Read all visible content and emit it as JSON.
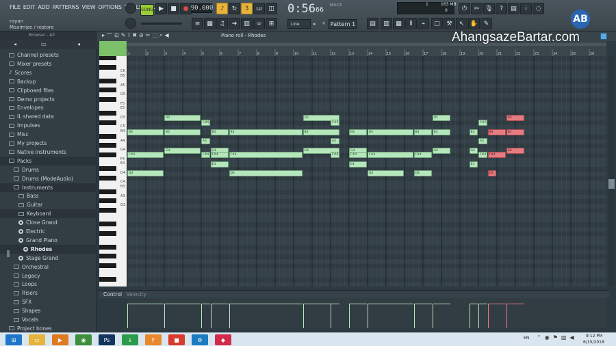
{
  "menu": [
    "FILE",
    "EDIT",
    "ADD",
    "PATTERNS",
    "VIEW",
    "OPTIONS",
    "TOOLS",
    "HELP"
  ],
  "hint": {
    "name": "rayan",
    "description": "Maximize / restore"
  },
  "transport": {
    "mode": "SONG",
    "tempo": "90.000",
    "time": "0:56",
    "time_cs": "66",
    "time_unit": "M:S:CS"
  },
  "monitor": {
    "cpu": "1",
    "memory": "163 MB",
    "poly": "0"
  },
  "toolbar": {
    "snap": "Line",
    "pattern": "Pattern 1"
  },
  "browser": {
    "header": "Browser - All",
    "items": [
      {
        "label": "Channel presets",
        "indent": 1,
        "icon": "folder"
      },
      {
        "label": "Mixer presets",
        "indent": 1,
        "icon": "folder"
      },
      {
        "label": "Scores",
        "indent": 1,
        "icon": "note"
      },
      {
        "label": "Backup",
        "indent": 1,
        "icon": "folder"
      },
      {
        "label": "Clipboard files",
        "indent": 1,
        "icon": "folder"
      },
      {
        "label": "Demo projects",
        "indent": 1,
        "icon": "folder"
      },
      {
        "label": "Envelopes",
        "indent": 1,
        "icon": "folder"
      },
      {
        "label": "IL shared data",
        "indent": 1,
        "icon": "folder"
      },
      {
        "label": "Impulses",
        "indent": 1,
        "icon": "folder"
      },
      {
        "label": "Misc",
        "indent": 1,
        "icon": "folder"
      },
      {
        "label": "My projects",
        "indent": 1,
        "icon": "folder"
      },
      {
        "label": "Native Instruments",
        "indent": 1,
        "icon": "folder"
      },
      {
        "label": "Packs",
        "indent": 1,
        "icon": "folder",
        "selected": true
      },
      {
        "label": "Drums",
        "indent": 2,
        "icon": "folder"
      },
      {
        "label": "Drums (ModeAudio)",
        "indent": 2,
        "icon": "folder"
      },
      {
        "label": "Instruments",
        "indent": 2,
        "icon": "folder",
        "selected": true
      },
      {
        "label": "Bass",
        "indent": 3,
        "icon": "folder"
      },
      {
        "label": "Guitar",
        "indent": 3,
        "icon": "folder"
      },
      {
        "label": "Keyboard",
        "indent": 3,
        "icon": "folder",
        "selected": true
      },
      {
        "label": "Close Grand",
        "indent": 3,
        "icon": "gear"
      },
      {
        "label": "Electric",
        "indent": 3,
        "icon": "gear"
      },
      {
        "label": "Grand Piano",
        "indent": 3,
        "icon": "gear"
      },
      {
        "label": "Rhodes",
        "indent": 4,
        "icon": "gear",
        "selected": true,
        "bold": true
      },
      {
        "label": "Stage Grand",
        "indent": 3,
        "icon": "gear"
      },
      {
        "label": "Orchestral",
        "indent": 2,
        "icon": "folder"
      },
      {
        "label": "Legacy",
        "indent": 2,
        "icon": "folder"
      },
      {
        "label": "Loops",
        "indent": 2,
        "icon": "folder"
      },
      {
        "label": "Risers",
        "indent": 2,
        "icon": "folder"
      },
      {
        "label": "SFX",
        "indent": 2,
        "icon": "folder"
      },
      {
        "label": "Shapes",
        "indent": 2,
        "icon": "folder"
      },
      {
        "label": "Vocals",
        "indent": 2,
        "icon": "folder"
      },
      {
        "label": "Project bones",
        "indent": 1,
        "icon": "folder"
      }
    ]
  },
  "piano_roll": {
    "title": "Piano roll - Rhodes",
    "bars": [
      "1",
      "2",
      "3",
      "4",
      "5",
      "6",
      "7",
      "8",
      "9",
      "10",
      "11",
      "12",
      "13",
      "14",
      "15",
      "16",
      "17",
      "18",
      "19",
      "20",
      "21",
      "22",
      "23",
      "24",
      "25",
      "26"
    ],
    "key_labels": [
      "C6",
      "B5",
      "A5",
      "G5",
      "F5",
      "E5",
      "D5",
      "C5",
      "B4",
      "A4",
      "G4",
      "F4",
      "E4",
      "D4",
      "C4",
      "B3",
      "A3",
      "G3"
    ],
    "notes": [
      {
        "pitch": "D5",
        "start": 3.0,
        "len": 2.0,
        "color": "green"
      },
      {
        "pitch": "D5",
        "start": 10.5,
        "len": 2.0,
        "color": "green"
      },
      {
        "pitch": "D5",
        "start": 17.5,
        "len": 1.0,
        "color": "green"
      },
      {
        "pitch": "D5",
        "start": 21.5,
        "len": 1.0,
        "color": "red"
      },
      {
        "pitch": "C#5",
        "start": 5.0,
        "len": 0.5,
        "color": "green"
      },
      {
        "pitch": "C#5",
        "start": 12.0,
        "len": 0.5,
        "color": "green"
      },
      {
        "pitch": "C#5",
        "start": 20.0,
        "len": 0.5,
        "color": "green"
      },
      {
        "pitch": "B4",
        "start": 1.0,
        "len": 2.0,
        "color": "green"
      },
      {
        "pitch": "B4",
        "start": 3.0,
        "len": 2.0,
        "color": "green"
      },
      {
        "pitch": "B4",
        "start": 5.5,
        "len": 1.0,
        "color": "green"
      },
      {
        "pitch": "B4",
        "start": 6.5,
        "len": 4.0,
        "color": "green"
      },
      {
        "pitch": "B4",
        "start": 10.5,
        "len": 2.0,
        "color": "green"
      },
      {
        "pitch": "B4",
        "start": 13.0,
        "len": 1.0,
        "color": "green"
      },
      {
        "pitch": "B4",
        "start": 14.0,
        "len": 2.5,
        "color": "green"
      },
      {
        "pitch": "B4",
        "start": 16.5,
        "len": 1.0,
        "color": "green"
      },
      {
        "pitch": "B4",
        "start": 17.5,
        "len": 1.0,
        "color": "green"
      },
      {
        "pitch": "B4",
        "start": 19.5,
        "len": 0.5,
        "color": "green"
      },
      {
        "pitch": "B4",
        "start": 20.5,
        "len": 1.0,
        "color": "red"
      },
      {
        "pitch": "B4",
        "start": 21.5,
        "len": 1.0,
        "color": "red"
      },
      {
        "pitch": "A4",
        "start": 5.0,
        "len": 0.5,
        "color": "green"
      },
      {
        "pitch": "A4",
        "start": 12.0,
        "len": 0.5,
        "color": "green"
      },
      {
        "pitch": "A4",
        "start": 20.0,
        "len": 0.5,
        "color": "green"
      },
      {
        "pitch": "G4",
        "start": 3.0,
        "len": 2.0,
        "color": "green"
      },
      {
        "pitch": "G4",
        "start": 5.5,
        "len": 1.0,
        "color": "green"
      },
      {
        "pitch": "G4",
        "start": 10.5,
        "len": 2.0,
        "color": "green"
      },
      {
        "pitch": "G4",
        "start": 13.0,
        "len": 1.0,
        "color": "green"
      },
      {
        "pitch": "G4",
        "start": 17.5,
        "len": 1.0,
        "color": "green"
      },
      {
        "pitch": "G4",
        "start": 19.5,
        "len": 0.5,
        "color": "green"
      },
      {
        "pitch": "G4",
        "start": 21.5,
        "len": 1.0,
        "color": "red"
      },
      {
        "pitch": "F#4",
        "start": 1.0,
        "len": 2.0,
        "color": "green"
      },
      {
        "pitch": "F#4",
        "start": 5.0,
        "len": 0.5,
        "color": "green"
      },
      {
        "pitch": "F#4",
        "start": 5.5,
        "len": 1.0,
        "color": "green"
      },
      {
        "pitch": "F#4",
        "start": 6.5,
        "len": 4.0,
        "color": "green"
      },
      {
        "pitch": "F#4",
        "start": 12.0,
        "len": 0.5,
        "color": "green"
      },
      {
        "pitch": "F#4",
        "start": 13.0,
        "len": 1.0,
        "color": "green"
      },
      {
        "pitch": "F#4",
        "start": 14.0,
        "len": 2.5,
        "color": "green"
      },
      {
        "pitch": "F#4",
        "start": 16.5,
        "len": 1.0,
        "color": "green"
      },
      {
        "pitch": "F#4",
        "start": 20.0,
        "len": 0.5,
        "color": "green"
      },
      {
        "pitch": "F#4",
        "start": 20.5,
        "len": 1.0,
        "color": "red"
      },
      {
        "pitch": "E4",
        "start": 5.5,
        "len": 1.0,
        "color": "green"
      },
      {
        "pitch": "E4",
        "start": 13.0,
        "len": 1.0,
        "color": "green"
      },
      {
        "pitch": "E4",
        "start": 19.5,
        "len": 0.5,
        "color": "green"
      },
      {
        "pitch": "D4",
        "start": 1.0,
        "len": 2.0,
        "color": "green"
      },
      {
        "pitch": "D4",
        "start": 6.5,
        "len": 4.0,
        "color": "green"
      },
      {
        "pitch": "D4",
        "start": 14.0,
        "len": 2.0,
        "color": "green"
      },
      {
        "pitch": "D4",
        "start": 16.5,
        "len": 1.0,
        "color": "green"
      },
      {
        "pitch": "D4",
        "start": 20.5,
        "len": 0.5,
        "color": "red"
      }
    ],
    "control_label": "Control",
    "control_param": "Velocity"
  },
  "watermark": "AhangsazeBartar.com",
  "logo": "AB",
  "taskbar": {
    "apps": [
      {
        "name": "windows-start",
        "color": "#1f76c9",
        "glyph": "⊞"
      },
      {
        "name": "explorer",
        "color": "#e6b43c",
        "glyph": "▭"
      },
      {
        "name": "media-player",
        "color": "#e07a1e",
        "glyph": "▶"
      },
      {
        "name": "chrome",
        "color": "#3d8f3d",
        "glyph": "◉"
      },
      {
        "name": "photoshop",
        "color": "#14345e",
        "glyph": "Ps"
      },
      {
        "name": "internet-download",
        "color": "#2a9b4a",
        "glyph": "↓"
      },
      {
        "name": "fl-studio",
        "color": "#e8892e",
        "glyph": "F"
      },
      {
        "name": "camtasia",
        "color": "#d93a2b",
        "glyph": "■"
      },
      {
        "name": "settings",
        "color": "#1a7bc0",
        "glyph": "⚙"
      },
      {
        "name": "app-red",
        "color": "#d22b4a",
        "glyph": "◆"
      }
    ],
    "lang": "EN",
    "time": "9:12 PM",
    "date": "6/15/2018"
  },
  "colors": {
    "note_green": "#b6e6bc",
    "note_red": "#e57c82",
    "accent_orange": "#e8b33c"
  }
}
